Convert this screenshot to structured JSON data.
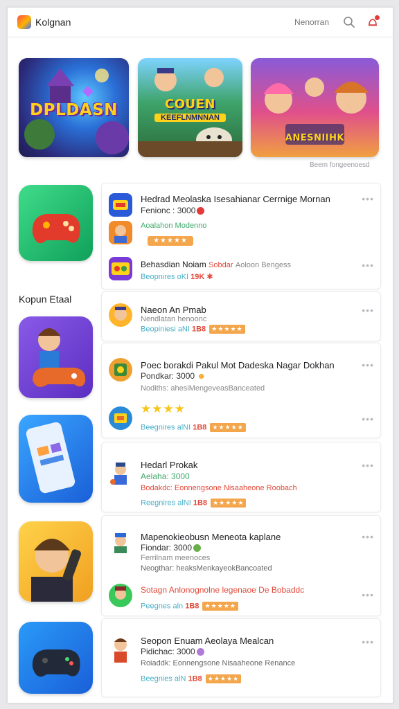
{
  "header": {
    "title": "Kolgnan",
    "nav_link": "Nenorran"
  },
  "banners": [
    {
      "title": "DPLDASN",
      "subtitle": ""
    },
    {
      "title": "COUEN",
      "subtitle": "KEEFLNMNNAN"
    },
    {
      "title": "ANESNIIHK",
      "subtitle": ""
    }
  ],
  "banner_caption": "Beem fongeenoesd",
  "section_title": "Kopun Etaal",
  "cards": [
    {
      "rows": [
        {
          "title": "Hedrad Meolaska Isesahianar Cerrnige Mornan",
          "subtitle": "Fenionc : 3000",
          "more": "•••"
        },
        {
          "title": "Aoalahon Modenno",
          "rating": "★★★★★"
        },
        {
          "title": "Behasdian Noiam",
          "badge": "Sobdar",
          "extra": "Aoloon Bengess",
          "meta": "Beopnires oKI",
          "price": "19K",
          "more": "•••"
        }
      ]
    },
    {
      "rows": [
        {
          "title": "Naeon An Pmab",
          "subtitle": "Nendlatan henoonc",
          "meta": "Beopiniesi aNI",
          "price": "1B8",
          "rating": "★★★★★",
          "more": "•••"
        }
      ]
    },
    {
      "rows": [
        {
          "title": "Poec borakdi Pakul Mot Dadeska Nagar Dokhan",
          "subtitle": "Pondkar: 3000",
          "detail": "Nodiths: ahesiMengeveasBanceated",
          "more": "•••"
        },
        {
          "stars": "★★★★",
          "meta": "Beegnires alNI",
          "price": "1B8",
          "rating": "★★★★★",
          "more": "•••"
        }
      ]
    },
    {
      "rows": [
        {
          "title": "Hedarl Prokak",
          "subtitle": "Aelaha: 3000",
          "detail": "Bodakdc: Eonnengsone Nisaaheone Roobach",
          "meta": "Reegnires alNI",
          "price": "1B8",
          "rating": "★★★★★",
          "more": "•••"
        }
      ]
    },
    {
      "rows": [
        {
          "title": "Mapenokieobusn Meneota kaplane",
          "subtitle": "Fiondar: 3000",
          "detail_muted": "Ferrilnam meenoces",
          "detail": "Neogthar: heaksMenkayeokBancoated",
          "more": "•••"
        },
        {
          "title": "Sotagn Anlonognolne legenaoe De Bobaddc",
          "meta": "Peegnes aln",
          "price": "1B8",
          "rating": "★★★★★",
          "more": "•••"
        }
      ]
    },
    {
      "rows": [
        {
          "title": "Seopon Enuam Aeolaya Mealcan",
          "subtitle": "Pidichac: 3000",
          "detail": "Roiaddk: Eonnengsone Nisaaheone Renance",
          "meta": "Beegnies alN",
          "price": "1B8",
          "rating": "★★★★★",
          "more": "•••"
        }
      ]
    }
  ],
  "colors": {
    "accent_orange": "#f3a64c",
    "price_red": "#e24a3a",
    "meta_teal": "#4ab0c8",
    "star_yellow": "#f5c518"
  }
}
